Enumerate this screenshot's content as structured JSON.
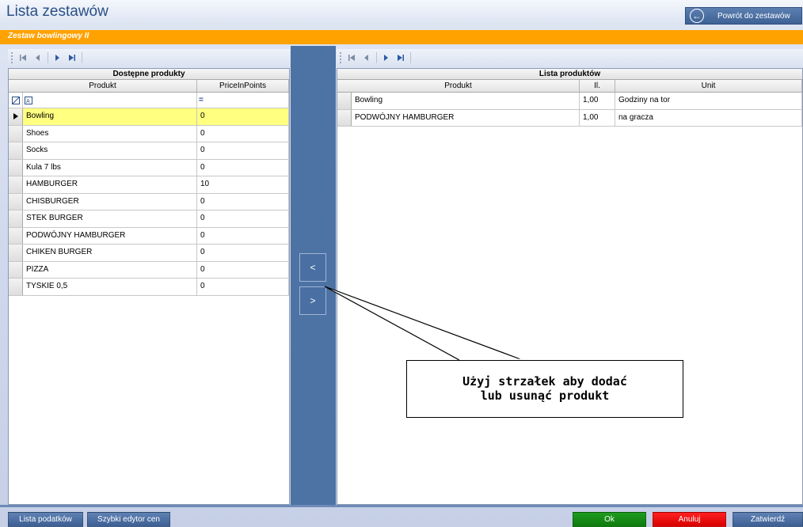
{
  "window": {
    "title": "Lista zestawów",
    "back_label": "Powrót do zestawów"
  },
  "set_name": "Zestaw bowlingowy II",
  "left_grid": {
    "group_header": "Dostępne produkty",
    "columns": [
      "Produkt",
      "PriceInPoints"
    ],
    "filter_operator": "=",
    "rows": [
      [
        "Bowling",
        "0"
      ],
      [
        "Shoes",
        "0"
      ],
      [
        "Socks",
        "0"
      ],
      [
        "Kula 7 lbs",
        "0"
      ],
      [
        "HAMBURGER",
        "10"
      ],
      [
        "CHISBURGER",
        "0"
      ],
      [
        "STEK BURGER",
        "0"
      ],
      [
        "PODWÓJNY HAMBURGER",
        "0"
      ],
      [
        "CHIKEN BURGER",
        "0"
      ],
      [
        "PIZZA",
        "0"
      ],
      [
        "TYSKIE 0,5",
        "0"
      ]
    ]
  },
  "right_grid": {
    "group_header": "Lista produktów",
    "columns": [
      "Produkt",
      "Il.",
      "Unit"
    ],
    "rows": [
      [
        "Bowling",
        "1,00",
        "Godziny na tor"
      ],
      [
        "PODWÓJNY HAMBURGER",
        "1,00",
        "na gracza"
      ]
    ]
  },
  "transfer": {
    "add_label": "<",
    "remove_label": ">"
  },
  "callout": {
    "line1": "Użyj strzałek aby dodać",
    "line2": "lub usunąć produkt"
  },
  "footer": {
    "tax_list": "Lista podatków",
    "price_editor": "Szybki edytor cen",
    "ok": "Ok",
    "cancel": "Anuluj",
    "confirm": "Zatwierdź"
  },
  "colors": {
    "accent_orange": "#ffa200",
    "selected_row": "#ffff80",
    "ok_green": "#1e9c1e",
    "cancel_red": "#ff2020"
  }
}
